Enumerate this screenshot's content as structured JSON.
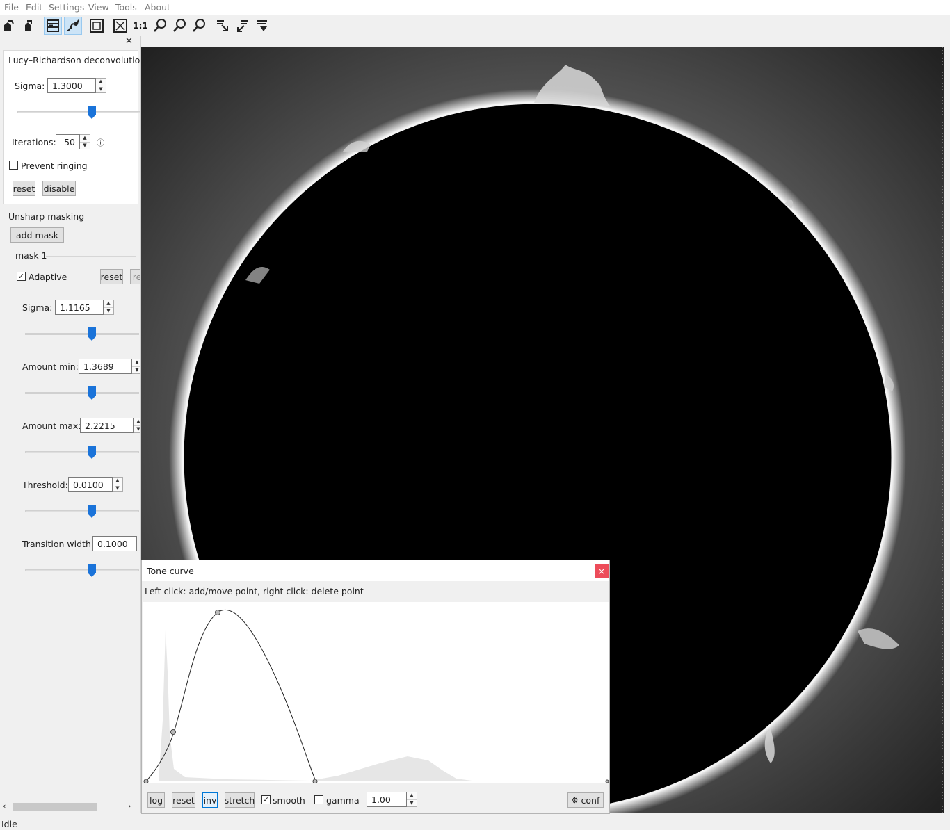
{
  "menu": {
    "file": "File",
    "edit": "Edit",
    "settings": "Settings",
    "view": "View",
    "tools": "Tools",
    "about": "About"
  },
  "toolbar": {
    "icons": [
      "open-icon",
      "save-icon",
      "panel-toggle-icon",
      "tone-curve-icon",
      "fit-window-icon",
      "fit-alt-icon",
      "actual-size-icon",
      "zoom-icon",
      "zoom-in-icon",
      "zoom-out-icon",
      "align-icon",
      "stack-icon",
      "download-icon"
    ],
    "actual_size_label": "1:1"
  },
  "lucy": {
    "title": "Lucy–Richardson deconvolution",
    "sigma_label": "Sigma:",
    "sigma_value": "1.3000",
    "sigma_slider": 0.5,
    "iterations_label": "Iterations:",
    "iterations_value": "50",
    "info_icon": "ⓘ",
    "prevent_ringing_label": "Prevent ringing",
    "prevent_ringing_checked": false,
    "reset_label": "reset",
    "disable_label": "disable"
  },
  "unsharp": {
    "title": "Unsharp masking",
    "add_mask_label": "add mask",
    "mask": {
      "title": "mask 1",
      "adaptive_label": "Adaptive",
      "adaptive_checked": true,
      "reset_label": "reset",
      "sigma_label": "Sigma:",
      "sigma_value": "1.1165",
      "amount_min_label": "Amount min:",
      "amount_min_value": "1.3689",
      "amount_max_label": "Amount max:",
      "amount_max_value": "2.2215",
      "threshold_label": "Threshold:",
      "threshold_value": "0.0100",
      "transition_label": "Transition width:",
      "transition_value": "0.1000"
    }
  },
  "tone_curve": {
    "title": "Tone curve",
    "close_label": "×",
    "hint": "Left click: add/move point, right click: delete point",
    "log_label": "log",
    "reset_label": "reset",
    "inv_label": "inv",
    "stretch_label": "stretch",
    "smooth_label": "smooth",
    "smooth_checked": true,
    "gamma_label": "gamma",
    "gamma_checked": false,
    "gamma_value": "1.00",
    "conf_label": "conf"
  },
  "status": {
    "text": "Idle"
  },
  "colors": {
    "slider_thumb": "#1a73d9",
    "accent_selected": "#cce4f7",
    "close_red": "#e81123"
  }
}
